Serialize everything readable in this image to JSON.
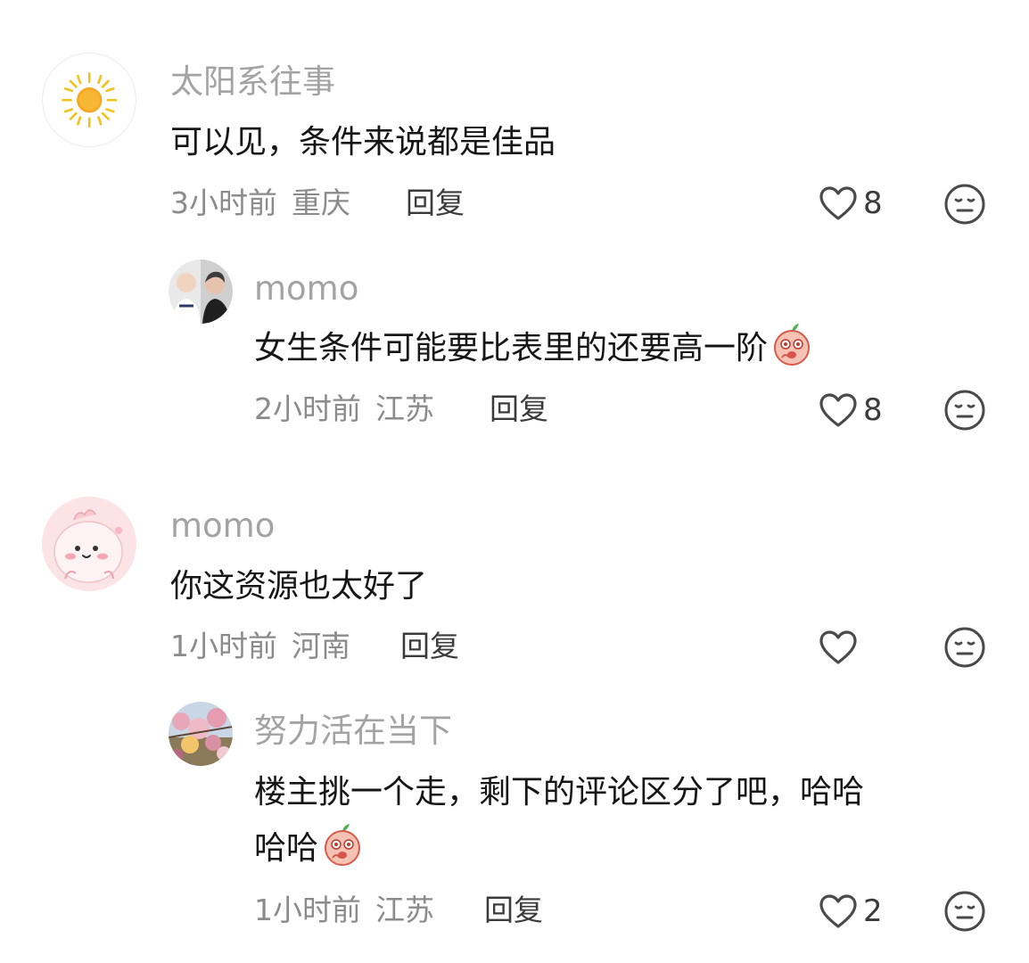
{
  "comments": [
    {
      "username": "太阳系往事",
      "text": "可以见，条件来说都是佳品",
      "time": "3小时前",
      "location": "重庆",
      "reply_label": "回复",
      "likes": "8",
      "avatar_icon": "sun-icon"
    },
    {
      "username": "momo",
      "text": "女生条件可能要比表里的还要高一阶",
      "emoji": "peach-emoji",
      "time": "2小时前",
      "location": "江苏",
      "reply_label": "回复",
      "likes": "8",
      "avatar_icon": "two-people-photo"
    },
    {
      "username": "momo",
      "text": "你这资源也太好了",
      "time": "1小时前",
      "location": "河南",
      "reply_label": "回复",
      "likes": "",
      "avatar_icon": "pink-cartoon-avatar"
    },
    {
      "username": "努力活在当下",
      "text_line1": "楼主挑一个走，剩下的评论区分了吧，哈哈",
      "text_line2": "哈哈",
      "emoji": "peach-emoji",
      "time": "1小时前",
      "location": "江苏",
      "reply_label": "回复",
      "likes": "2",
      "avatar_icon": "blossom-photo"
    }
  ],
  "colors": {
    "username": "#a3a3a3",
    "body_text": "#161616",
    "meta": "#8b8b8b",
    "icon": "#4a4a4a"
  }
}
